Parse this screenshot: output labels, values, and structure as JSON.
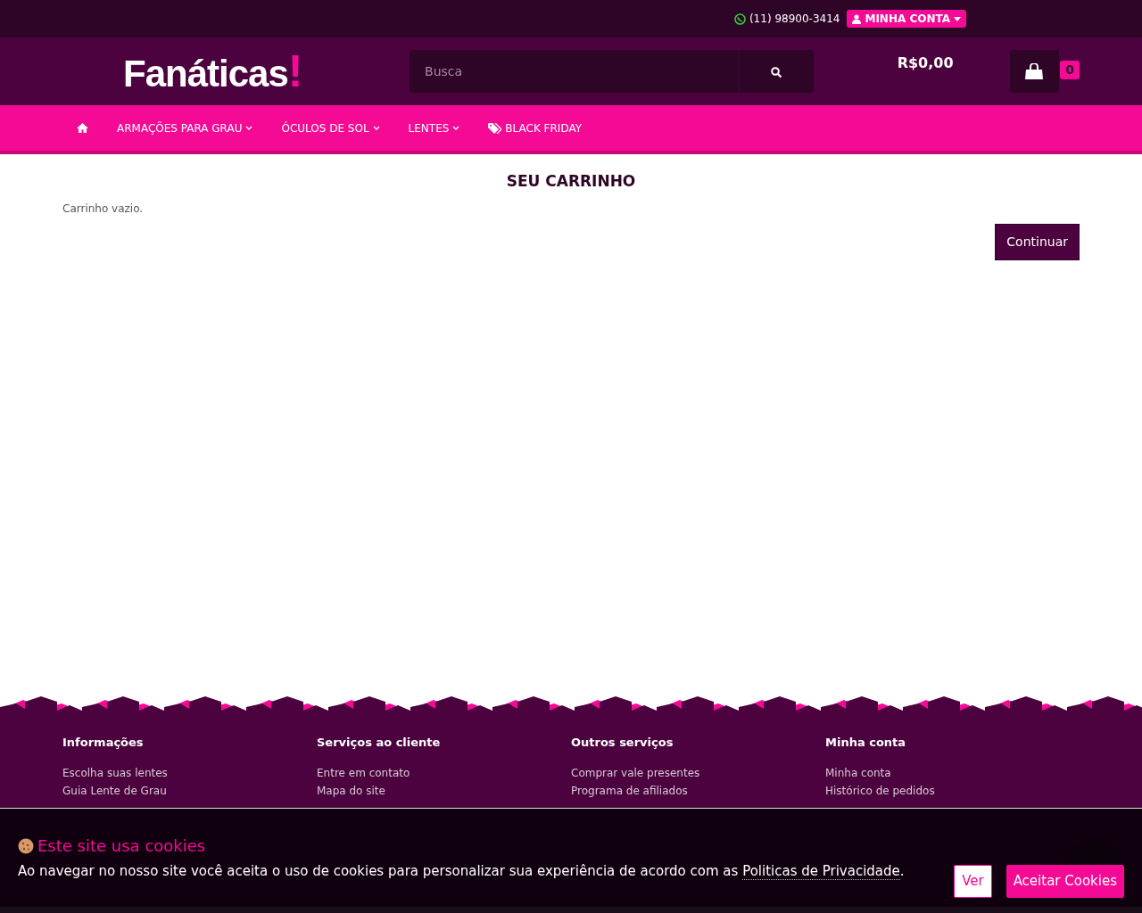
{
  "topbar": {
    "phone": "(11) 98900-3414",
    "account_button": "MINHA CONTA"
  },
  "header": {
    "logo": {
      "text": "Fanáticas",
      "mark": "!"
    },
    "search": {
      "placeholder": "Busca"
    },
    "cart_total": "R$0,00",
    "cart_count": "0"
  },
  "nav": [
    {
      "kind": "home"
    },
    {
      "kind": "dropdown",
      "label": "ARMAÇÕES PARA GRAU"
    },
    {
      "kind": "dropdown",
      "label": "ÓCULOS DE SOL"
    },
    {
      "kind": "dropdown",
      "label": "LENTES"
    },
    {
      "kind": "tag",
      "label": "BLACK FRIDAY"
    }
  ],
  "cart": {
    "title": "SEU CARRINHO",
    "message": "Carrinho vazio.",
    "continue_button": "Continuar"
  },
  "footer": {
    "columns": [
      {
        "heading": "Informações",
        "links": [
          "Escolha suas lentes",
          "Guia Lente de Grau"
        ]
      },
      {
        "heading": "Serviços ao cliente",
        "links": [
          "Entre em contato",
          "Mapa do site"
        ]
      },
      {
        "heading": "Outros serviços",
        "links": [
          "Comprar vale presentes",
          "Programa de afiliados"
        ]
      },
      {
        "heading": "Minha conta",
        "links": [
          "Minha conta",
          "Histórico de pedidos"
        ]
      }
    ]
  },
  "cookie_banner": {
    "title": "Este site usa cookies",
    "text": "Ao navegar no nosso site você aceita o uso de cookies para personalizar sua experiência de acordo com as",
    "link": "Politicas de Privacidade",
    "after_link": ".",
    "buttons": [
      {
        "label": "Ver",
        "kind": "outline"
      },
      {
        "label": "Aceitar Cookies",
        "kind": "solid"
      }
    ]
  }
}
